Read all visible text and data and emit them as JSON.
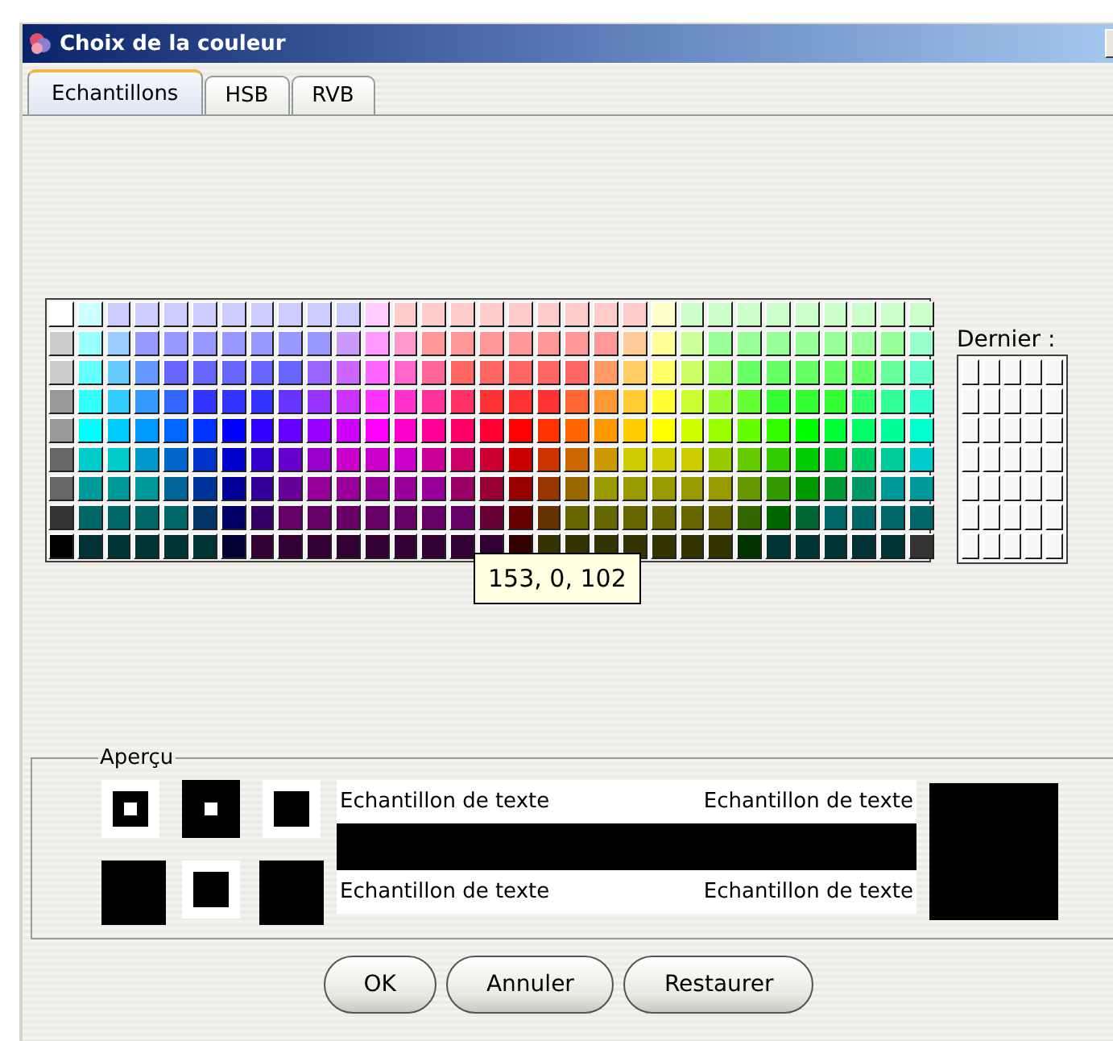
{
  "window": {
    "title": "Choix de la couleur"
  },
  "tabs": [
    {
      "label": "Echantillons",
      "selected": true
    },
    {
      "label": "HSB",
      "selected": false
    },
    {
      "label": "RVB",
      "selected": false
    }
  ],
  "swatches": [
    [
      {
        "color": "#ffffff"
      },
      {
        "color": "#ccffff"
      },
      {
        "color": "#ccccff"
      },
      {
        "color": "#ccccff"
      },
      {
        "color": "#ccccff"
      },
      {
        "color": "#ccccff"
      },
      {
        "color": "#ccccff"
      },
      {
        "color": "#ccccff"
      },
      {
        "color": "#ccccff"
      },
      {
        "color": "#ccccff"
      },
      {
        "color": "#ccccff"
      },
      {
        "color": "#ffccff"
      },
      {
        "color": "#ffcccc"
      },
      {
        "color": "#ffcccc"
      },
      {
        "color": "#ffcccc"
      },
      {
        "color": "#ffcccc"
      },
      {
        "color": "#ffcccc"
      },
      {
        "color": "#ffcccc"
      },
      {
        "color": "#ffcccc"
      },
      {
        "color": "#ffcccc"
      },
      {
        "color": "#ffcccc"
      },
      {
        "color": "#ffffcc"
      },
      {
        "color": "#ccffcc"
      },
      {
        "color": "#ccffcc"
      },
      {
        "color": "#ccffcc"
      },
      {
        "color": "#ccffcc"
      },
      {
        "color": "#ccffcc"
      },
      {
        "color": "#ccffcc"
      },
      {
        "color": "#ccffcc"
      },
      {
        "color": "#ccffcc"
      },
      {
        "color": "#ccffcc"
      }
    ],
    [
      {
        "color": "#cccccc"
      },
      {
        "color": "#99ffff"
      },
      {
        "color": "#99ccff"
      },
      {
        "color": "#9999ff"
      },
      {
        "color": "#9999ff"
      },
      {
        "color": "#9999ff"
      },
      {
        "color": "#9999ff"
      },
      {
        "color": "#9999ff"
      },
      {
        "color": "#9999ff"
      },
      {
        "color": "#9999ff"
      },
      {
        "color": "#cc99ff"
      },
      {
        "color": "#ff99ff"
      },
      {
        "color": "#ff99cc"
      },
      {
        "color": "#ff9999"
      },
      {
        "color": "#ff9999"
      },
      {
        "color": "#ff9999"
      },
      {
        "color": "#ff9999"
      },
      {
        "color": "#ff9999"
      },
      {
        "color": "#ff9999"
      },
      {
        "color": "#ff9999"
      },
      {
        "color": "#ffcc99"
      },
      {
        "color": "#ffff99"
      },
      {
        "color": "#ccff99"
      },
      {
        "color": "#99ff99"
      },
      {
        "color": "#99ff99"
      },
      {
        "color": "#99ff99"
      },
      {
        "color": "#99ff99"
      },
      {
        "color": "#99ff99"
      },
      {
        "color": "#99ff99"
      },
      {
        "color": "#99ff99"
      },
      {
        "color": "#99ffcc"
      }
    ],
    [
      {
        "color": "#cccccc"
      },
      {
        "color": "#66ffff"
      },
      {
        "color": "#66ccff"
      },
      {
        "color": "#6699ff"
      },
      {
        "color": "#6666ff"
      },
      {
        "color": "#6666ff"
      },
      {
        "color": "#6666ff"
      },
      {
        "color": "#6666ff"
      },
      {
        "color": "#6666ff"
      },
      {
        "color": "#9966ff"
      },
      {
        "color": "#cc66ff"
      },
      {
        "color": "#ff66ff"
      },
      {
        "color": "#ff66cc"
      },
      {
        "color": "#ff6699"
      },
      {
        "color": "#ff6666"
      },
      {
        "color": "#ff6666"
      },
      {
        "color": "#ff6666"
      },
      {
        "color": "#ff6666"
      },
      {
        "color": "#ff6666"
      },
      {
        "color": "#ff9966"
      },
      {
        "color": "#ffcc66"
      },
      {
        "color": "#ffff66"
      },
      {
        "color": "#ccff66"
      },
      {
        "color": "#99ff66"
      },
      {
        "color": "#66ff66"
      },
      {
        "color": "#66ff66"
      },
      {
        "color": "#66ff66"
      },
      {
        "color": "#66ff66"
      },
      {
        "color": "#66ff66"
      },
      {
        "color": "#66ff99"
      },
      {
        "color": "#66ffcc"
      }
    ],
    [
      {
        "color": "#999999"
      },
      {
        "color": "#33ffff"
      },
      {
        "color": "#33ccff"
      },
      {
        "color": "#3399ff"
      },
      {
        "color": "#3366ff"
      },
      {
        "color": "#3333ff"
      },
      {
        "color": "#3333ff"
      },
      {
        "color": "#3333ff"
      },
      {
        "color": "#6633ff"
      },
      {
        "color": "#9933ff"
      },
      {
        "color": "#cc33ff"
      },
      {
        "color": "#ff33ff"
      },
      {
        "color": "#ff33cc"
      },
      {
        "color": "#ff3399"
      },
      {
        "color": "#ff3366"
      },
      {
        "color": "#ff3333"
      },
      {
        "color": "#ff3333"
      },
      {
        "color": "#ff3333"
      },
      {
        "color": "#ff6633"
      },
      {
        "color": "#ff9933"
      },
      {
        "color": "#ffcc33"
      },
      {
        "color": "#ffff33"
      },
      {
        "color": "#ccff33"
      },
      {
        "color": "#99ff33"
      },
      {
        "color": "#66ff33"
      },
      {
        "color": "#33ff33"
      },
      {
        "color": "#33ff33"
      },
      {
        "color": "#33ff33"
      },
      {
        "color": "#33ff66"
      },
      {
        "color": "#33ff99"
      },
      {
        "color": "#33ffcc"
      }
    ],
    [
      {
        "color": "#999999"
      },
      {
        "color": "#00ffff"
      },
      {
        "color": "#00ccff"
      },
      {
        "color": "#0099ff"
      },
      {
        "color": "#0066ff"
      },
      {
        "color": "#0033ff"
      },
      {
        "color": "#0000ff"
      },
      {
        "color": "#3300ff"
      },
      {
        "color": "#6600ff"
      },
      {
        "color": "#9900ff"
      },
      {
        "color": "#cc00ff"
      },
      {
        "color": "#ff00ff"
      },
      {
        "color": "#ff00cc"
      },
      {
        "color": "#ff0099"
      },
      {
        "color": "#ff0066"
      },
      {
        "color": "#ff0033"
      },
      {
        "color": "#ff0000"
      },
      {
        "color": "#ff3300"
      },
      {
        "color": "#ff6600"
      },
      {
        "color": "#ff9900"
      },
      {
        "color": "#ffcc00"
      },
      {
        "color": "#ffff00"
      },
      {
        "color": "#ccff00"
      },
      {
        "color": "#99ff00"
      },
      {
        "color": "#66ff00"
      },
      {
        "color": "#33ff00"
      },
      {
        "color": "#00ff00"
      },
      {
        "color": "#00ff33"
      },
      {
        "color": "#00ff66"
      },
      {
        "color": "#00ff99"
      },
      {
        "color": "#00ffcc"
      }
    ],
    [
      {
        "color": "#666666"
      },
      {
        "color": "#00cccc"
      },
      {
        "color": "#00cccc"
      },
      {
        "color": "#0099cc"
      },
      {
        "color": "#0066cc"
      },
      {
        "color": "#0033cc"
      },
      {
        "color": "#0000cc"
      },
      {
        "color": "#3300cc"
      },
      {
        "color": "#6600cc"
      },
      {
        "color": "#9900cc"
      },
      {
        "color": "#cc00cc"
      },
      {
        "color": "#cc00cc"
      },
      {
        "color": "#cc00cc"
      },
      {
        "color": "#cc0099"
      },
      {
        "color": "#cc0066"
      },
      {
        "color": "#cc0033"
      },
      {
        "color": "#cc0000"
      },
      {
        "color": "#cc3300"
      },
      {
        "color": "#cc6600"
      },
      {
        "color": "#cc9900"
      },
      {
        "color": "#cccc00"
      },
      {
        "color": "#cccc00"
      },
      {
        "color": "#cccc00"
      },
      {
        "color": "#99cc00"
      },
      {
        "color": "#66cc00"
      },
      {
        "color": "#33cc00"
      },
      {
        "color": "#00cc00"
      },
      {
        "color": "#00cc33"
      },
      {
        "color": "#00cc66"
      },
      {
        "color": "#00cc99"
      },
      {
        "color": "#00cccc"
      }
    ],
    [
      {
        "color": "#666666"
      },
      {
        "color": "#009999"
      },
      {
        "color": "#009999"
      },
      {
        "color": "#009999"
      },
      {
        "color": "#006699"
      },
      {
        "color": "#003399"
      },
      {
        "color": "#000099"
      },
      {
        "color": "#330099"
      },
      {
        "color": "#660099"
      },
      {
        "color": "#990099"
      },
      {
        "color": "#990099"
      },
      {
        "color": "#990099"
      },
      {
        "color": "#990099"
      },
      {
        "color": "#990099"
      },
      {
        "color": "#990066"
      },
      {
        "color": "#990033"
      },
      {
        "color": "#990000"
      },
      {
        "color": "#993300"
      },
      {
        "color": "#996600"
      },
      {
        "color": "#999900"
      },
      {
        "color": "#999900"
      },
      {
        "color": "#999900"
      },
      {
        "color": "#999900"
      },
      {
        "color": "#999900"
      },
      {
        "color": "#669900"
      },
      {
        "color": "#339900"
      },
      {
        "color": "#009900"
      },
      {
        "color": "#009933"
      },
      {
        "color": "#009966"
      },
      {
        "color": "#009999"
      },
      {
        "color": "#009999"
      }
    ],
    [
      {
        "color": "#333333"
      },
      {
        "color": "#006666"
      },
      {
        "color": "#006666"
      },
      {
        "color": "#006666"
      },
      {
        "color": "#006666"
      },
      {
        "color": "#003366"
      },
      {
        "color": "#000066"
      },
      {
        "color": "#330066"
      },
      {
        "color": "#660066"
      },
      {
        "color": "#660066"
      },
      {
        "color": "#660066"
      },
      {
        "color": "#660066"
      },
      {
        "color": "#660066"
      },
      {
        "color": "#660066"
      },
      {
        "color": "#660066"
      },
      {
        "color": "#660033"
      },
      {
        "color": "#660000"
      },
      {
        "color": "#663300"
      },
      {
        "color": "#666600"
      },
      {
        "color": "#666600"
      },
      {
        "color": "#666600"
      },
      {
        "color": "#666600"
      },
      {
        "color": "#666600"
      },
      {
        "color": "#666600"
      },
      {
        "color": "#336600"
      },
      {
        "color": "#006600"
      },
      {
        "color": "#006633"
      },
      {
        "color": "#006666"
      },
      {
        "color": "#006666"
      },
      {
        "color": "#006666"
      },
      {
        "color": "#006666"
      }
    ],
    [
      {
        "color": "#000000"
      },
      {
        "color": "#003333"
      },
      {
        "color": "#003333"
      },
      {
        "color": "#003333"
      },
      {
        "color": "#003333"
      },
      {
        "color": "#003333"
      },
      {
        "color": "#000033"
      },
      {
        "color": "#330033"
      },
      {
        "color": "#330033"
      },
      {
        "color": "#330033"
      },
      {
        "color": "#330033"
      },
      {
        "color": "#330033"
      },
      {
        "color": "#330033"
      },
      {
        "color": "#330033"
      },
      {
        "color": "#330033"
      },
      {
        "color": "#330033"
      },
      {
        "color": "#330000"
      },
      {
        "color": "#333300"
      },
      {
        "color": "#333300"
      },
      {
        "color": "#333300"
      },
      {
        "color": "#333300"
      },
      {
        "color": "#333300"
      },
      {
        "color": "#333300"
      },
      {
        "color": "#333300"
      },
      {
        "color": "#003300"
      },
      {
        "color": "#003333"
      },
      {
        "color": "#003333"
      },
      {
        "color": "#003333"
      },
      {
        "color": "#003333"
      },
      {
        "color": "#003333"
      },
      {
        "color": "#333333"
      }
    ]
  ],
  "tooltip": "153, 0, 102",
  "recent": {
    "label": "Dernier :"
  },
  "preview": {
    "title": "Aperçu",
    "color": "#000000",
    "samples": [
      "Echantillon de texte",
      "Echantillon de texte",
      "Echantillon de texte",
      "Echantillon de texte"
    ]
  },
  "buttons": [
    "OK",
    "Annuler",
    "Restaurer"
  ]
}
